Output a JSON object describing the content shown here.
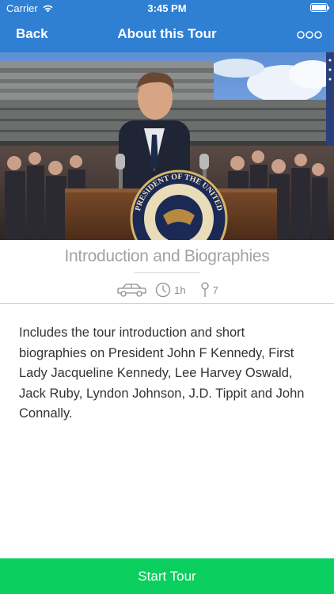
{
  "status_bar": {
    "carrier": "Carrier",
    "time": "3:45 PM",
    "icons": [
      "wifi-icon",
      "battery-icon"
    ]
  },
  "nav": {
    "back_label": "Back",
    "title": "About this Tour",
    "more_icon": "ellipsis-icon"
  },
  "tour": {
    "title": "Introduction and Biographies",
    "transport_icon": "car-icon",
    "duration": "1h",
    "stops": "7",
    "description": "Includes the tour introduction and short biographies on President John F Kennedy, First Lady Jacqueline Kennedy, Lee Harvey Oswald, Jack Ruby, Lyndon Johnson, J.D. Tippit and John Connally."
  },
  "hero": {
    "seal_text": "PRESIDENT OF THE UNITED"
  },
  "footer": {
    "start_label": "Start Tour"
  },
  "colors": {
    "nav_background": "#2f7fd3",
    "start_button": "#0bcf5f",
    "title_text": "#a2a2a2",
    "body_text": "#333333"
  }
}
